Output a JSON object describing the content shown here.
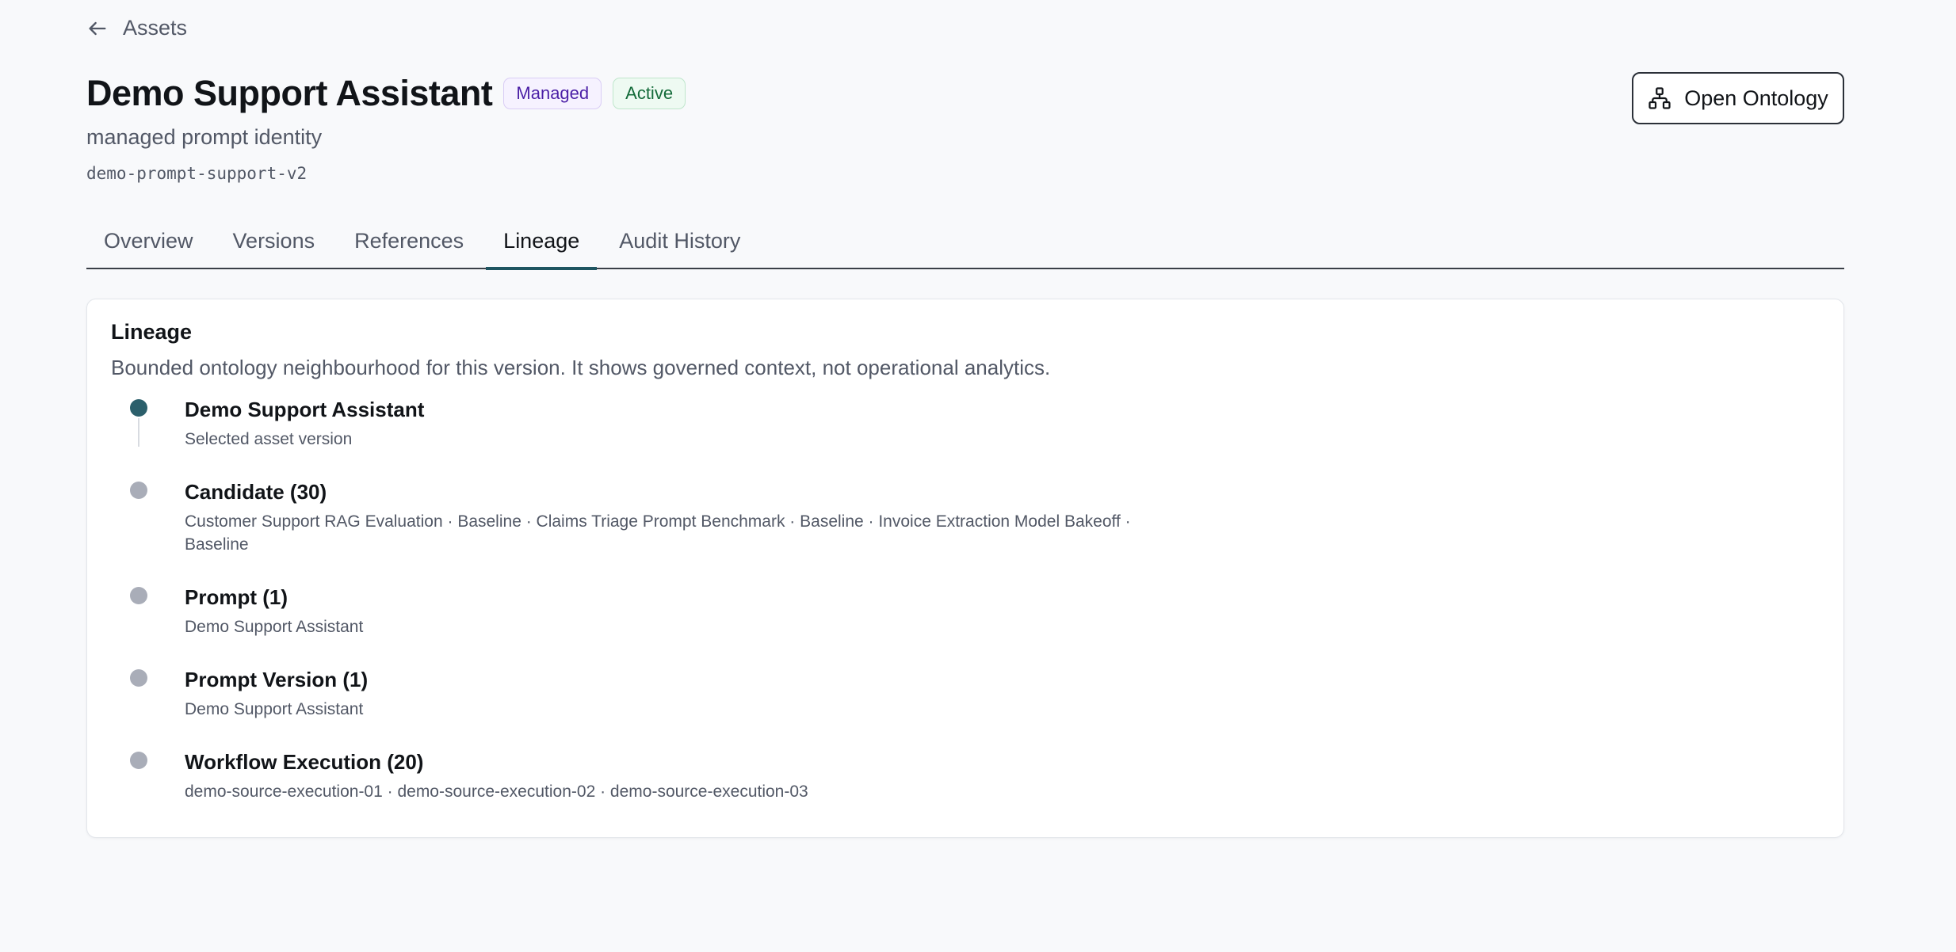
{
  "nav": {
    "back_label": "Assets"
  },
  "header": {
    "title": "Demo Support Assistant",
    "badges": {
      "managed": "Managed",
      "active": "Active"
    },
    "subtitle": "managed prompt identity",
    "slug": "demo-prompt-support-v2",
    "open_ontology_label": "Open Ontology"
  },
  "tabs": [
    {
      "label": "Overview"
    },
    {
      "label": "Versions"
    },
    {
      "label": "References"
    },
    {
      "label": "Lineage"
    },
    {
      "label": "Audit History"
    }
  ],
  "active_tab": "Lineage",
  "lineage": {
    "title": "Lineage",
    "description": "Bounded ontology neighbourhood for this version. It shows governed context, not operational analytics.",
    "items": [
      {
        "name": "Demo Support Assistant",
        "detail": "Selected asset version"
      },
      {
        "name": "Candidate (30)",
        "detail": "Customer Support RAG Evaluation · Baseline · Claims Triage Prompt Benchmark · Baseline · Invoice Extraction Model Bakeoff · Baseline"
      },
      {
        "name": "Prompt (1)",
        "detail": "Demo Support Assistant"
      },
      {
        "name": "Prompt Version (1)",
        "detail": "Demo Support Assistant"
      },
      {
        "name": "Workflow Execution (20)",
        "detail": "demo-source-execution-01 · demo-source-execution-02 · demo-source-execution-03"
      }
    ]
  },
  "colors": {
    "accent": "#1f5561",
    "selected_dot": "#2b5f6b",
    "inactive_dot": "#a9adb8"
  }
}
